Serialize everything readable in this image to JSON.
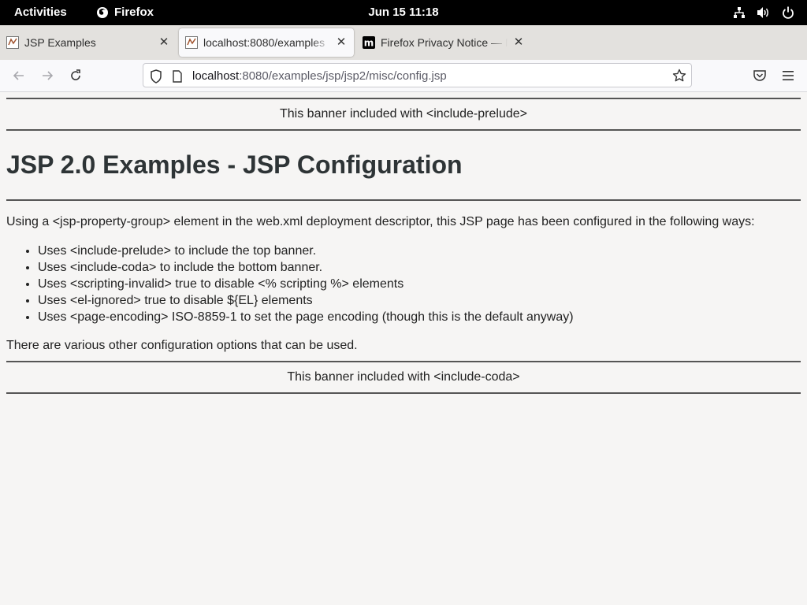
{
  "system": {
    "activities": "Activities",
    "app_name": "Firefox",
    "clock": "Jun 15  11:18"
  },
  "tabs": [
    {
      "title": "JSP Examples",
      "favicon": "tomcat-favicon-icon",
      "active": false
    },
    {
      "title": "localhost:8080/examples",
      "favicon": "tomcat-favicon-icon",
      "active": true
    },
    {
      "title": "Firefox Privacy Notice — M",
      "favicon": "mozilla-m-icon",
      "active": false
    }
  ],
  "urlbar": {
    "host": "localhost",
    "rest": ":8080/examples/jsp/jsp2/misc/config.jsp"
  },
  "page": {
    "prelude_banner": "This banner included with <include-prelude>",
    "heading": "JSP 2.0 Examples - JSP Configuration",
    "intro": "Using a <jsp-property-group> element in the web.xml deployment descriptor, this JSP page has been configured in the following ways:",
    "items": [
      "Uses <include-prelude> to include the top banner.",
      "Uses <include-coda> to include the bottom banner.",
      "Uses <scripting-invalid> true to disable <% scripting %> elements",
      "Uses <el-ignored> true to disable ${EL} elements",
      "Uses <page-encoding> ISO-8859-1 to set the page encoding (though this is the default anyway)"
    ],
    "outro": "There are various other configuration options that can be used.",
    "coda_banner": "This banner included with <include-coda>"
  },
  "colors": {
    "topbar": "#000000",
    "tabstrip": "#e3e1de",
    "page_bg": "#f6f5f4",
    "heading": "#2e3436"
  }
}
